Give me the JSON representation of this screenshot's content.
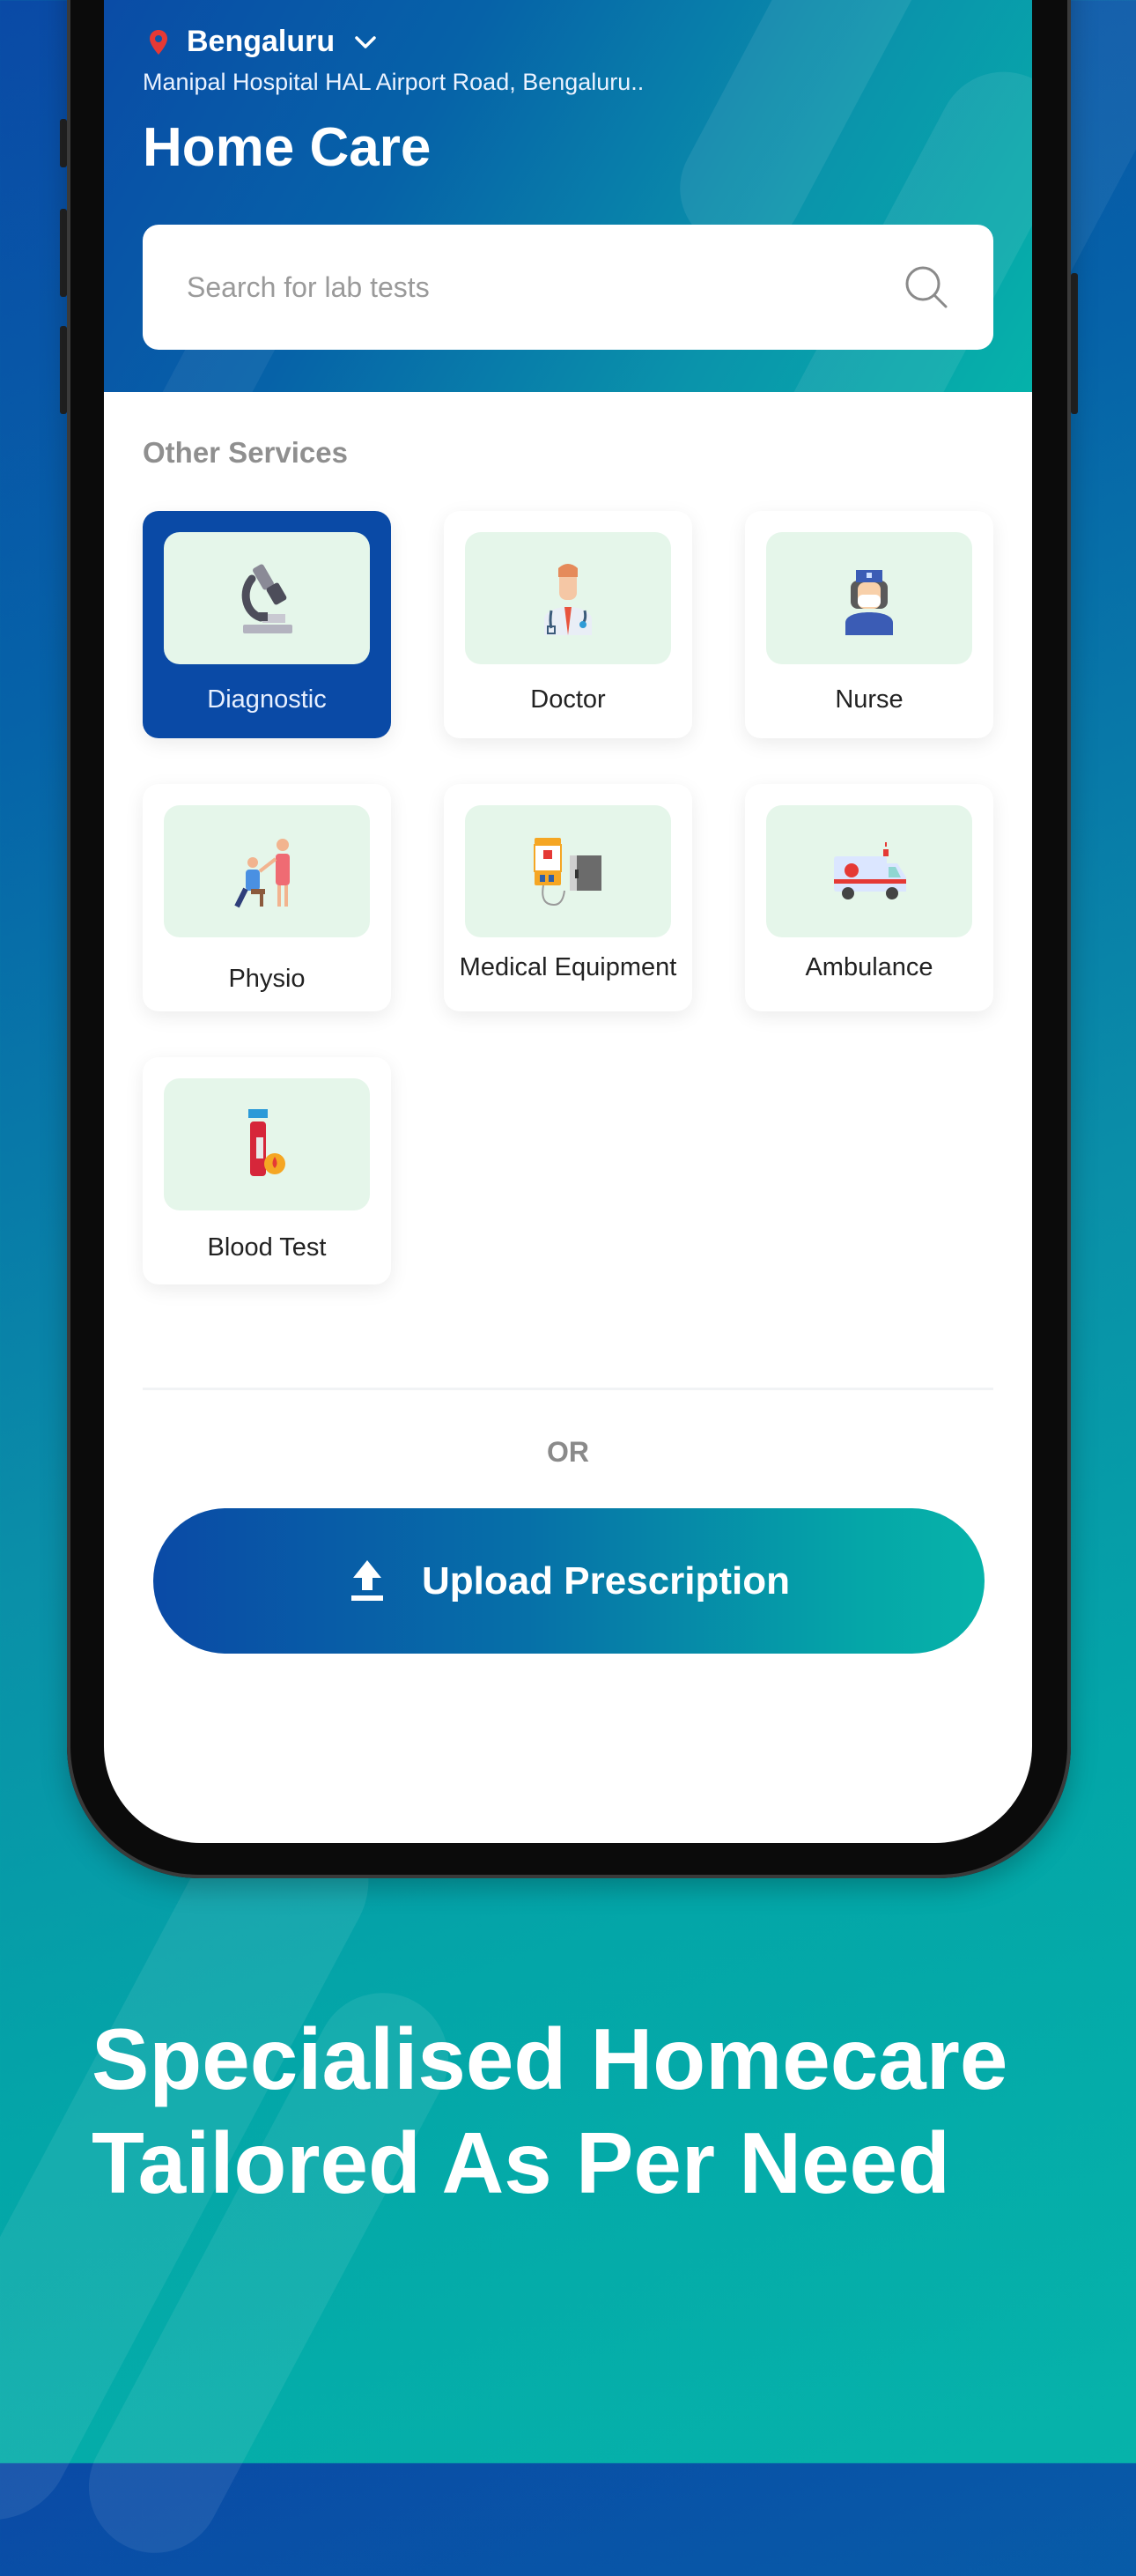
{
  "header": {
    "city": "Bengaluru",
    "address": "Manipal Hospital HAL Airport Road, Bengaluru..",
    "title": "Home Care",
    "icons": {
      "location": "map-pin-icon",
      "dropdown": "chevron-down-icon"
    }
  },
  "search": {
    "placeholder": "Search for lab tests",
    "value": "",
    "icon": "search-icon"
  },
  "services": {
    "section_label": "Other Services",
    "selected": "Diagnostic",
    "items": [
      {
        "label": "Diagnostic",
        "icon": "microscope-icon"
      },
      {
        "label": "Doctor",
        "icon": "doctor-icon"
      },
      {
        "label": "Nurse",
        "icon": "nurse-icon"
      },
      {
        "label": "Physio",
        "icon": "physiotherapy-icon"
      },
      {
        "label": "Medical Equipment",
        "icon": "medical-equipment-icon"
      },
      {
        "label": "Ambulance",
        "icon": "ambulance-icon"
      },
      {
        "label": "Blood Test",
        "icon": "blood-test-tube-icon"
      }
    ]
  },
  "separator_text": "OR",
  "upload": {
    "label": "Upload Prescription",
    "icon": "upload-icon"
  },
  "promo": {
    "line1": "Specialised Homecare",
    "line2": "Tailored As Per Need"
  },
  "colors": {
    "brand_blue": "#0a4aa6",
    "brand_teal": "#06b3aa",
    "thumb_bg": "#e5f6ea",
    "pin_red": "#e53935"
  }
}
